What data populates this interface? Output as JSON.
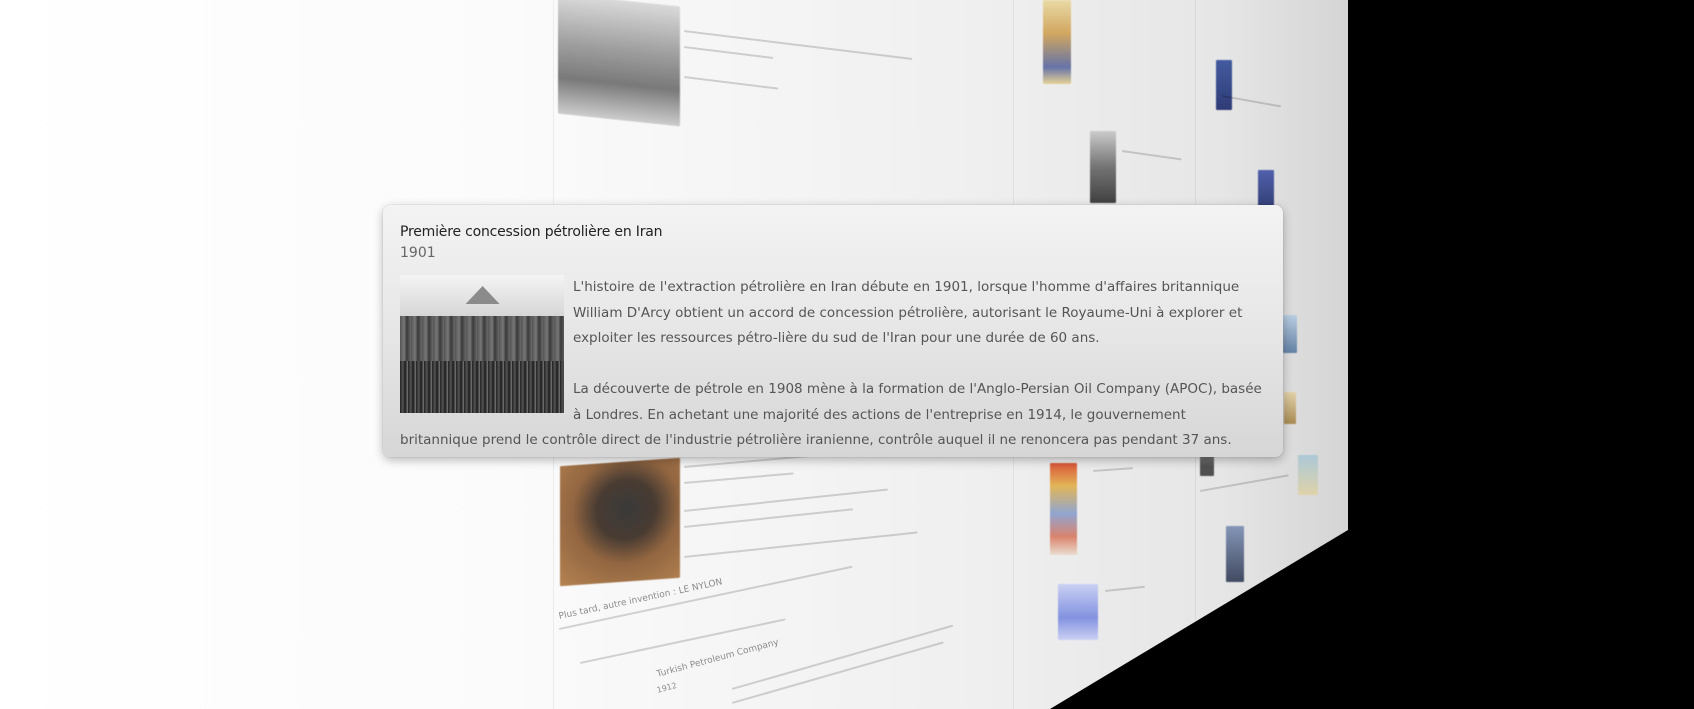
{
  "popup": {
    "title": "Première concession pétrolière en Iran",
    "date": "1901",
    "paragraph_1": "L'histoire de l'extraction pétrolière en Iran débute en 1901, lorsque l'homme d'affaires britannique William D'Arcy obtient un accord de concession pétrolière, autorisant le Royaume-Uni à explorer et exploiter les ressources pétro-lière du sud de l'Iran pour une durée de 60 ans.",
    "paragraph_2": "La découverte de pétrole en 1908 mène à la formation de l'Anglo-Persian Oil Company (APOC), basée à Londres. En achetant une majorité des actions de l'entreprise en 1914, le gouvernement britannique prend le contrôle direct de l'industrie pétrolière iranienne, contrôle auquel il ne renoncera pas pendant 37 ans.",
    "photo_icon": "historic-building-crowd-photo"
  },
  "background": {
    "nylon_heading": "Plus tard, autre invention : LE NYLON",
    "turkish_heading": "Turkish Petroleum Company",
    "turkish_year": "1912"
  },
  "colors": {
    "popup_bg": "#e8e8e8",
    "page_bg": "#ffffff",
    "outside": "#000000"
  }
}
